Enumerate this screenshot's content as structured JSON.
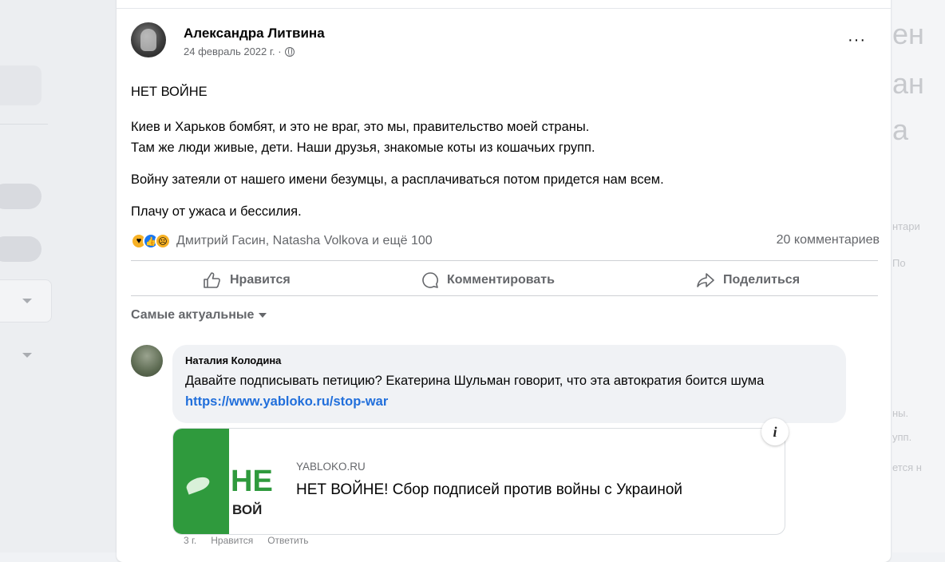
{
  "post": {
    "author": "Александра Литвина",
    "date": "24 февраль 2022 г. ·",
    "more_label": "···",
    "paragraphs": [
      "НЕТ ВОЙНЕ",
      "Киев и Харьков бомбят, и это не враг, это мы, правительство моей страны.",
      "Там же люди живые, дети. Наши друзья, знакомые коты из кошачьих групп.",
      "Войну затеяли от нашего имени безумцы, а расплачиваться потом придется нам всем.",
      "Плачу от ужаса и бессилия."
    ],
    "reactors": "Дмитрий Гасин, Natasha Volkova и ещё 100",
    "comments_count": "20 комментариев"
  },
  "actions": {
    "like": "Нравится",
    "comment": "Комментировать",
    "share": "Поделиться"
  },
  "sort_label": "Самые актуальные",
  "comment": {
    "author": "Наталия Колодина",
    "text": "Давайте подписывать петицию? Екатерина Шульман говорит, что эта автократия боится шума ",
    "link": "https://www.yabloko.ru/stop-war"
  },
  "link_preview": {
    "domain": "YABLOKO.RU",
    "title": "НЕТ ВОЙНЕ! Сбор подписей против войны с Украиной",
    "image_big_text": "НЕ",
    "image_small_text": "ВОЙ",
    "info_icon": "i"
  },
  "comment_footer": {
    "age": "3 г.",
    "like": "Нравится",
    "reply": "Ответить"
  },
  "background": {
    "right_large": [
      "ен",
      "ан",
      "а"
    ],
    "right_small": [
      "нтари",
      "По",
      "ны.",
      "упп.",
      "ется н"
    ]
  },
  "colors": {
    "link": "#216fdb",
    "like_blue": "#1877f2",
    "reaction_yellow": "#f7b125",
    "preview_green": "#2f9a3d",
    "secondary_text": "#65676b"
  }
}
